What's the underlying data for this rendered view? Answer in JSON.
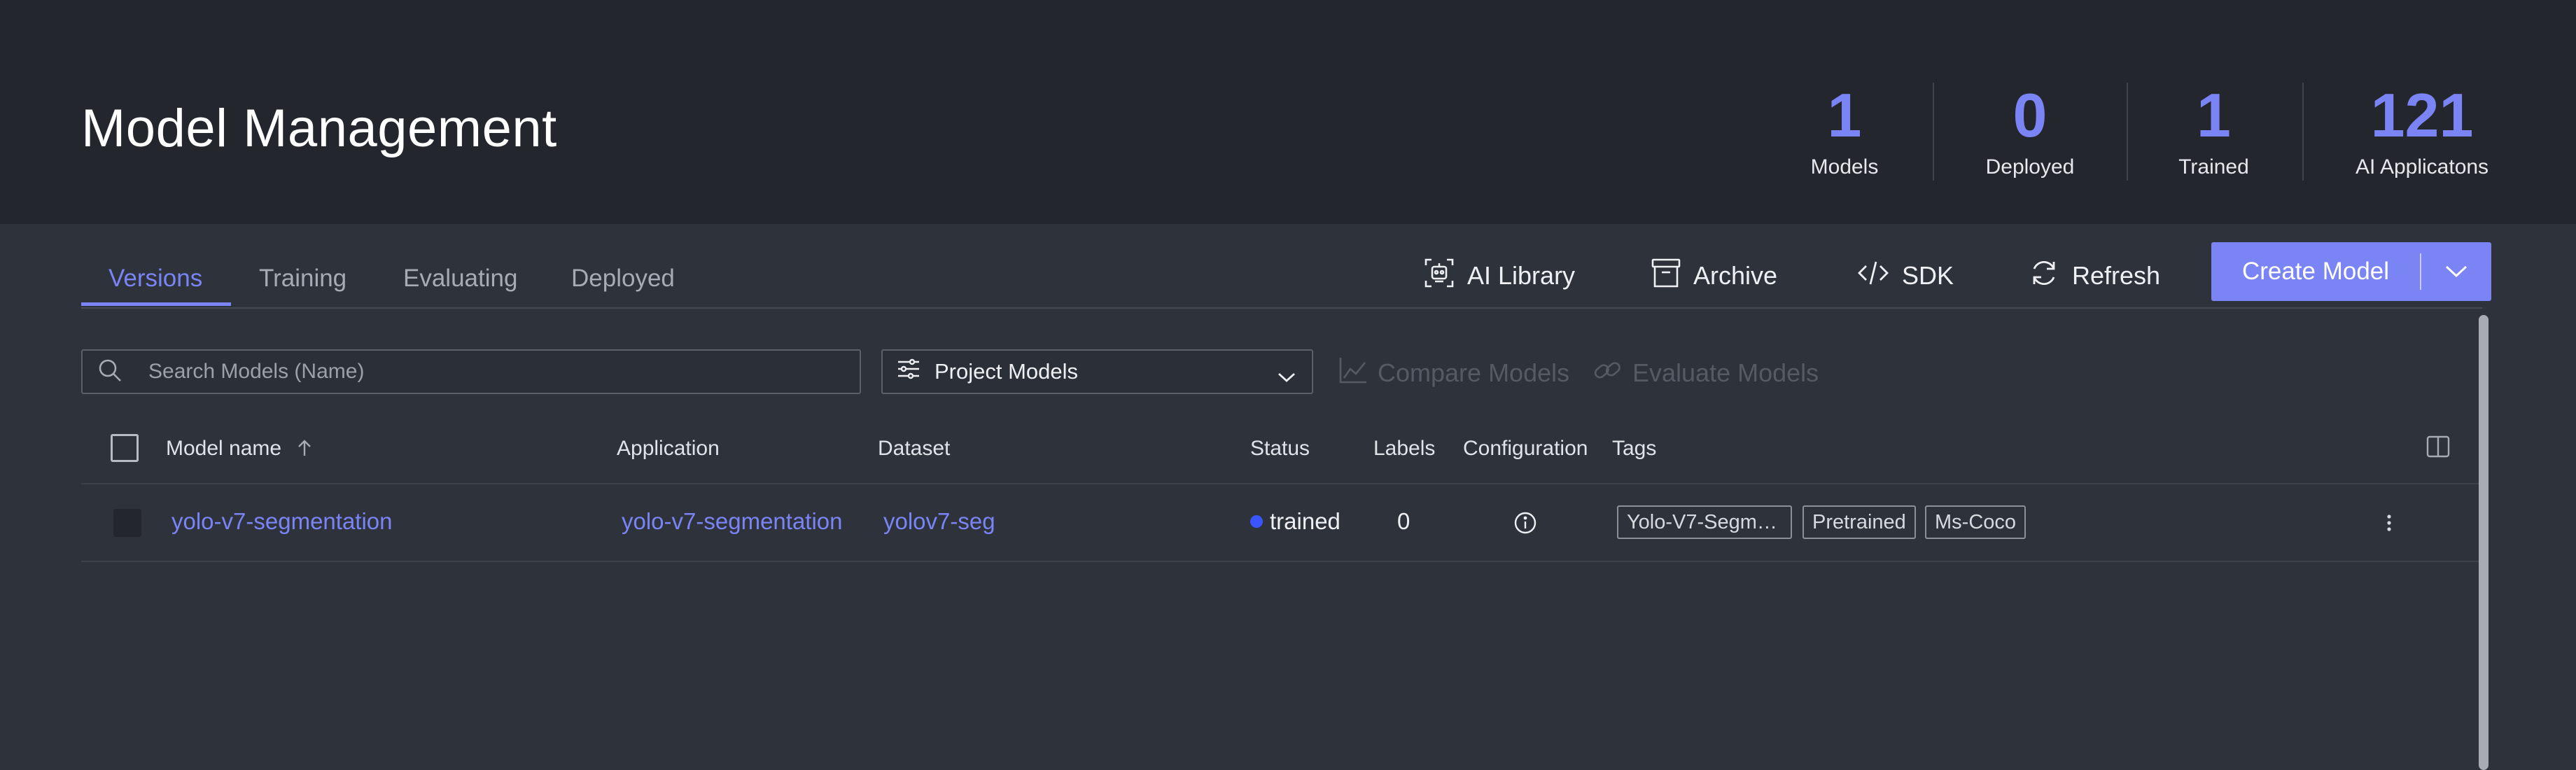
{
  "header": {
    "title": "Model Management",
    "stats": [
      {
        "value": "1",
        "label": "Models"
      },
      {
        "value": "0",
        "label": "Deployed"
      },
      {
        "value": "1",
        "label": "Trained"
      },
      {
        "value": "121",
        "label": "AI Applicatons"
      }
    ]
  },
  "tabs": [
    {
      "label": "Versions",
      "active": true
    },
    {
      "label": "Training",
      "active": false
    },
    {
      "label": "Evaluating",
      "active": false
    },
    {
      "label": "Deployed",
      "active": false
    }
  ],
  "toolbar": {
    "ai_library": {
      "label": "AI Library",
      "icon": "ai-library-icon"
    },
    "archive": {
      "label": "Archive",
      "icon": "archive-icon"
    },
    "sdk": {
      "label": "SDK",
      "icon": "code-icon"
    },
    "refresh": {
      "label": "Refresh",
      "icon": "refresh-icon"
    },
    "create_model": {
      "label": "Create Model",
      "icon": "chevron-down-icon"
    }
  },
  "filters": {
    "search_placeholder": "Search Models (Name)",
    "scope_select": "Project Models",
    "compare_models": "Compare Models",
    "evaluate_models": "Evaluate Models"
  },
  "table": {
    "columns": [
      "Model name",
      "Application",
      "Dataset",
      "Status",
      "Labels",
      "Configuration",
      "Tags"
    ],
    "sort": {
      "column": "Model name",
      "direction": "ascending"
    },
    "rows": [
      {
        "model_name": "yolo-v7-segmentation",
        "application": "yolo-v7-segmentation",
        "dataset": "yolov7-seg",
        "status": "trained",
        "labels": "0",
        "tags": [
          "Yolo-V7-Segm…",
          "Pretrained",
          "Ms-Coco"
        ]
      }
    ]
  },
  "colors": {
    "accent": "#7b84f5",
    "header_bg": "#23262d",
    "body_bg": "#2e323b",
    "status_trained": "#3a55ff"
  }
}
